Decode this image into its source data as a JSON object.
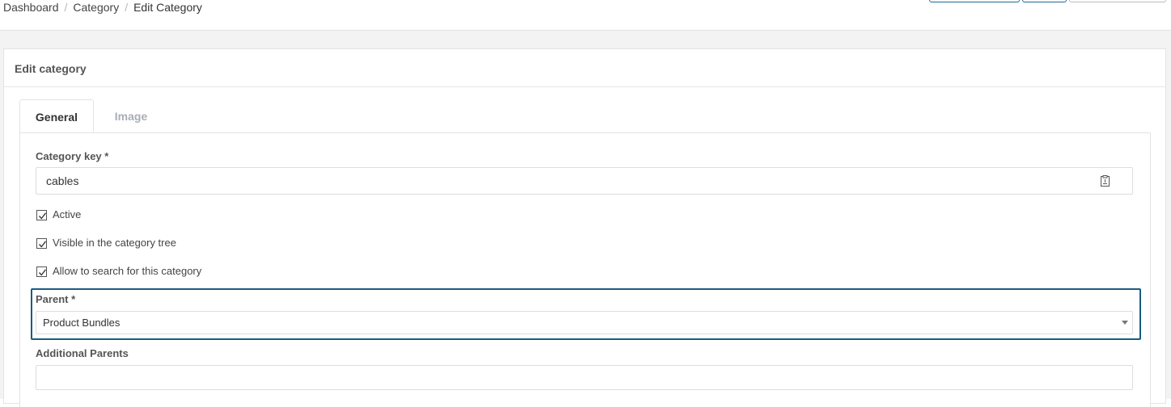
{
  "breadcrumb": {
    "items": [
      "Dashboard",
      "Category",
      "Edit Category"
    ],
    "separator": "/"
  },
  "card": {
    "title": "Edit category"
  },
  "tabs": [
    {
      "label": "General",
      "active": true
    },
    {
      "label": "Image",
      "active": false
    }
  ],
  "form": {
    "category_key": {
      "label": "Category key *",
      "value": "cables",
      "icon": "clipboard-icon"
    },
    "checkboxes": [
      {
        "label": "Active",
        "checked": true
      },
      {
        "label": "Visible in the category tree",
        "checked": true
      },
      {
        "label": "Allow to search for this category",
        "checked": true
      }
    ],
    "parent": {
      "label": "Parent *",
      "value": "Product Bundles"
    },
    "additional_parents": {
      "label": "Additional Parents",
      "value": ""
    }
  },
  "colors": {
    "accent": "#1a5c80",
    "tab_inactive": "#a8aeb8"
  }
}
